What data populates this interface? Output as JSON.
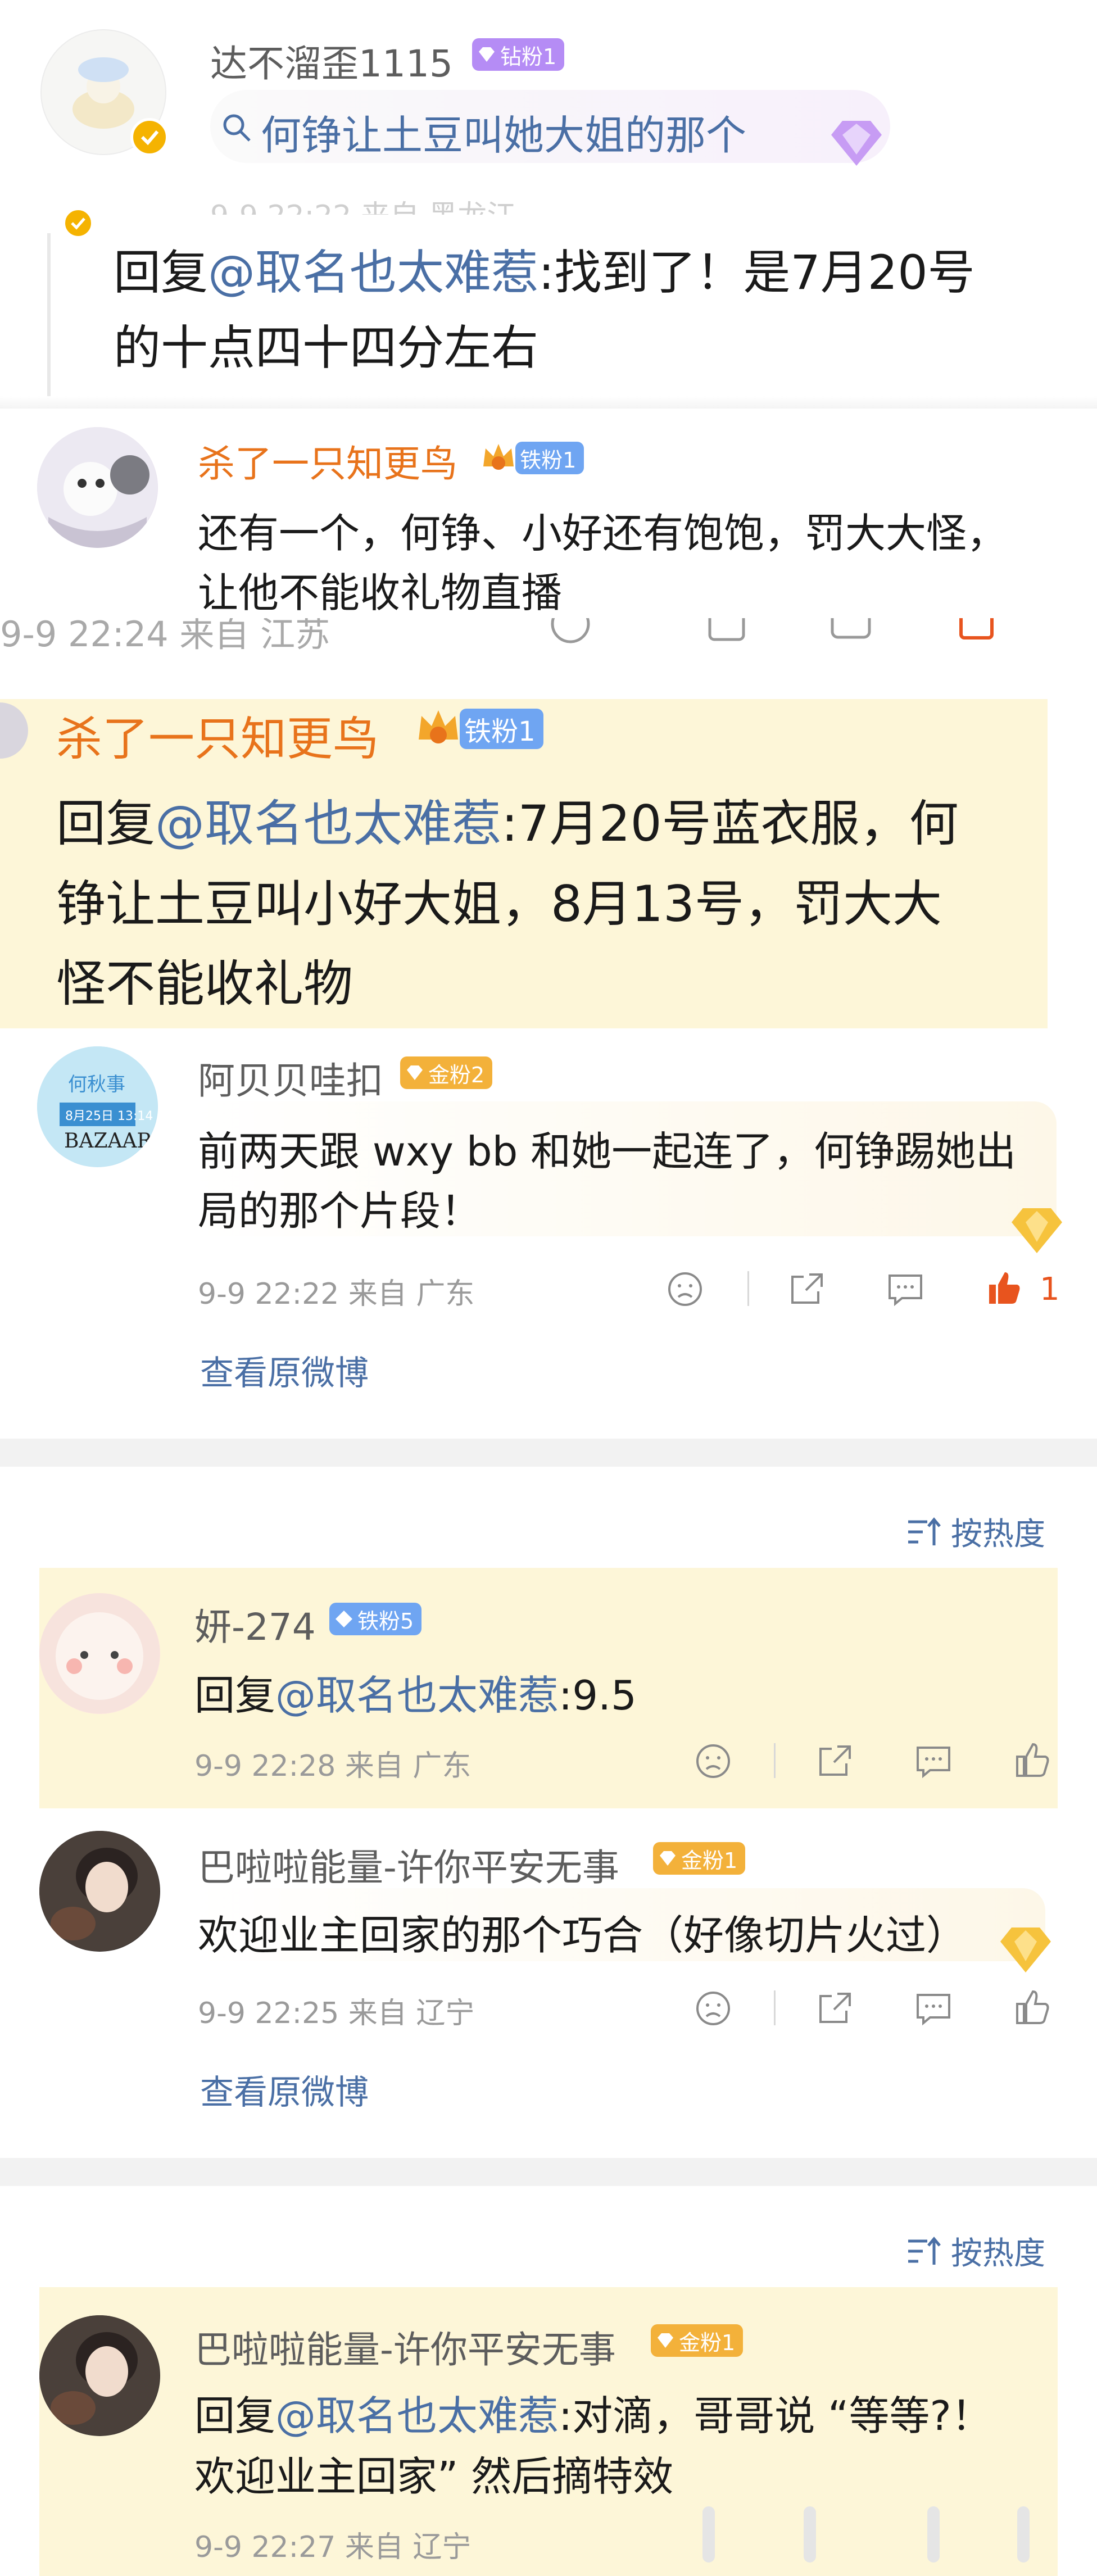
{
  "c1": {
    "name": "达不溜歪1115",
    "badge": "钻粉1",
    "search_text": "何铮让土豆叫她大姐的那个",
    "reply_prefix": "回复",
    "reply_mention": "@取名也太难惹",
    "reply_line1": ":找到了！是7月20号",
    "reply_line2": "的十点四十四分左右"
  },
  "c2": {
    "name": "杀了一只知更鸟",
    "badge": "铁粉1",
    "line1": "还有一个，何铮、小好还有饱饱，罚大大怪，",
    "line2": "让他不能收礼物直播",
    "meta_partial": "9-9 22:24  来自 江苏"
  },
  "c3": {
    "name": "杀了一只知更鸟",
    "badge": "铁粉1",
    "reply_prefix": "回复",
    "reply_mention": "@取名也太难惹",
    "line1": ":7月20号蓝衣服，何",
    "line2": "铮让土豆叫小好大姐，8月13号，罚大大",
    "line3": "怪不能收礼物"
  },
  "c4": {
    "name": "阿贝贝哇扣",
    "badge": "金粉2",
    "avatar_text": [
      "何秋事",
      "8月25日 13:14",
      "BAZAAR"
    ],
    "line1": "前两天跟 wxy bb 和她一起连了，何铮踢她出",
    "line2": "局的那个片段！",
    "meta": "9-9 22:22  来自 广东",
    "like_count": "1",
    "view_original": "查看原微博"
  },
  "section2": {
    "sort_label": "按热度"
  },
  "c5": {
    "name": "妍-274",
    "badge": "铁粉5",
    "reply_prefix": "回复",
    "reply_mention": "@取名也太难惹",
    "reply_text": ":9.5",
    "meta": "9-9 22:28  来自 广东"
  },
  "c6": {
    "name": "巴啦啦能量-许你平安无事",
    "badge": "金粉1",
    "line1": "欢迎业主回家的那个巧合（好像切片火过）",
    "meta": "9-9 22:25  来自 辽宁",
    "view_original": "查看原微博"
  },
  "section3": {
    "sort_label": "按热度"
  },
  "c7": {
    "name": "巴啦啦能量-许你平安无事",
    "badge": "金粉1",
    "reply_prefix": "回复",
    "reply_mention": "@取名也太难惹",
    "line1": ":对滴，哥哥说 “等等?！",
    "line2": "欢迎业主回家” 然后摘特效",
    "meta": "9-9 22:27  来自 辽宁"
  },
  "colors": {
    "highlight": "#fdf6d8",
    "mention": "#4a6fa5",
    "orange_name": "#e8731b",
    "like_red": "#e8541e"
  }
}
